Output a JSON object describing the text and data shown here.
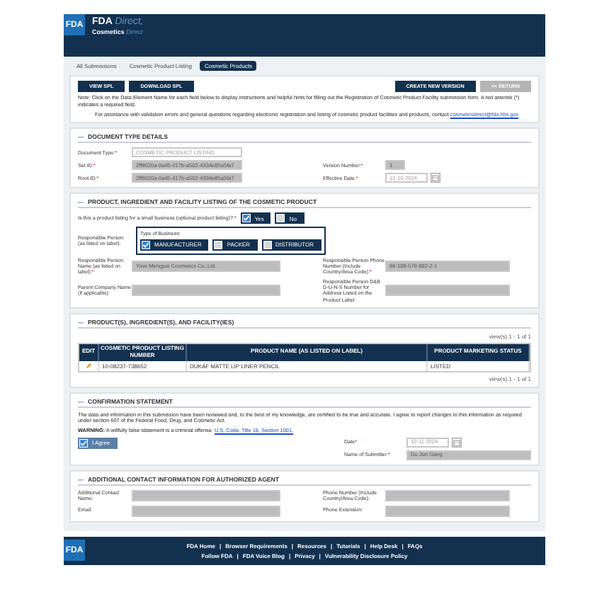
{
  "header": {
    "logo": "FDA",
    "brand": "FDA",
    "brand_suffix": "Direct,",
    "product": "Cosmetics",
    "product_suffix": "Direct"
  },
  "breadcrumb": [
    {
      "label": "All Submissions",
      "selected": false
    },
    {
      "label": "Cosmetic Product Listing",
      "selected": false
    },
    {
      "label": "Cosmetic Products",
      "selected": true
    }
  ],
  "toolbar": {
    "left": [
      {
        "label": "VIEW SPL",
        "disabled": false
      },
      {
        "label": "DOWNLOAD SPL",
        "disabled": false
      }
    ],
    "right": [
      {
        "label": "CREATE NEW VERSION",
        "disabled": false
      },
      {
        "label": "<< RETURN",
        "disabled": true
      }
    ]
  },
  "notes": {
    "text": "Note: Click on the Data Element Name for each field below to display instructions and helpful hints for filling out the Registration of Cosmetic Product Facility submission form. A red asterisk (*) indicates a required field.",
    "assist": "For assistance with validation errors and general questions regarding electronic registration and listing of cosmetic product facilities and products, contact",
    "assist_link": "cosmeticsdirect@fda.hhs.gov"
  },
  "document_type": {
    "title": "DOCUMENT TYPE DETAILS",
    "toggle": "—",
    "type": {
      "label": "Document Type:",
      "mark": "*",
      "value": "COSMETIC PRODUCT LISTING"
    },
    "set_id": {
      "label": "Set ID:",
      "mark": "*",
      "value": "2ff9020a-0a45-417b-a502-4334e85a5fa7"
    },
    "root_id": {
      "label": "Root ID:",
      "mark": "*",
      "value": "2ff9020a-0a45-417b-a502-4334e85a5fa7"
    },
    "version": {
      "label": "Version Number:",
      "mark": "*",
      "value": "1"
    },
    "effective_date": {
      "label": "Effective Date:",
      "mark": "*",
      "value": "12-10-2024"
    }
  },
  "listing": {
    "title": "PRODUCT, INGREDIENT AND FACILITY LISTING OF THE COSMETIC PRODUCT",
    "toggle": "—",
    "small_business": {
      "question": "Is this a product listing for a small business (optional product listing)?:",
      "mark": "*",
      "options": [
        {
          "label": "Yes",
          "checked": true
        },
        {
          "label": "No",
          "checked": false
        }
      ]
    },
    "responsible": {
      "label": "Responsible Person (as listed on label):",
      "group_label": "Type of Business:",
      "options": [
        {
          "label": "MANUFACTURER",
          "checked": true
        },
        {
          "label": "PACKER",
          "checked": false
        },
        {
          "label": "DISTRIBUTOR",
          "checked": false
        }
      ]
    },
    "rows": [
      {
        "label": "Responsible Person Name (as listed on label):",
        "mark": "*",
        "value": "Yiwu Mengjue Cosmetics Co.,Ltd.",
        "right_label": "Responsible Person Phone Number (Include Country/Area Code):",
        "right_mark": "*",
        "right_value": "86-188-579-882-2-1"
      },
      {
        "label": "Parent Company Name (if applicable):",
        "mark": "",
        "value": "",
        "right_label": "Responsible Person D&B D-U-N-S Number for Address Listed on the Product Label:",
        "right_mark": "",
        "right_value": ""
      }
    ]
  },
  "products": {
    "title": "PRODUCT(S), INGREDIENT(S), AND FACILITY(IES)",
    "toggle": "—",
    "pager_top": "view(s) 1 - 1 of 1",
    "pager_bottom": "view(s) 1 - 1 of 1",
    "columns": [
      "EDIT",
      "COSMETIC PRODUCT LISTING NUMBER",
      "PRODUCT NAME (AS LISTED ON LABEL)",
      "PRODUCT MARKETING STATUS"
    ],
    "rows": [
      {
        "listing_number": "10-08237-738652",
        "product_name": "DUKAF MATTE LIP LINER PENCIL",
        "status": "LISTED"
      }
    ]
  },
  "confirmation": {
    "title": "CONFIRMATION STATEMENT",
    "toggle": "—",
    "statement": "The data and information in this submission have been reviewed and, to the best of my knowledge, are certified to be true and accurate. I agree to report changes to this information as required under section 607 of the Federal Food, Drug, and Cosmetic Act.",
    "warning": "**WARNING:** A willfully false statement is a criminal offense.",
    "warning_link": "U.S. Code, Title 18, Section 1001.",
    "agree": {
      "label": "I Agree",
      "checked": true
    },
    "date": {
      "label": "Date",
      "mark": "*",
      "value": "12-11-2024"
    },
    "submitter": {
      "label": "Name of Submitter:",
      "mark": "*",
      "value": "Du Jun Gang"
    }
  },
  "agent": {
    "title": "ADDITIONAL CONTACT INFORMATION FOR AUTHORIZED AGENT",
    "toggle": "—",
    "rows": [
      {
        "label": "Additional Contact Name:",
        "right_label": "Phone Number (Include Country/Area Code):"
      },
      {
        "label": "Email:",
        "right_label": "Phone Extension:"
      }
    ]
  },
  "footer": {
    "logo": "FDA",
    "links_top": [
      "FDA Home",
      "Browser Requirements",
      "Resources",
      "Tutorials",
      "Help Desk",
      "FAQs"
    ],
    "links_bottom": [
      "Follow FDA",
      "FDA Voice Blog",
      "Privacy",
      "Vulnerability Disclosure Policy"
    ],
    "separator": "|"
  }
}
